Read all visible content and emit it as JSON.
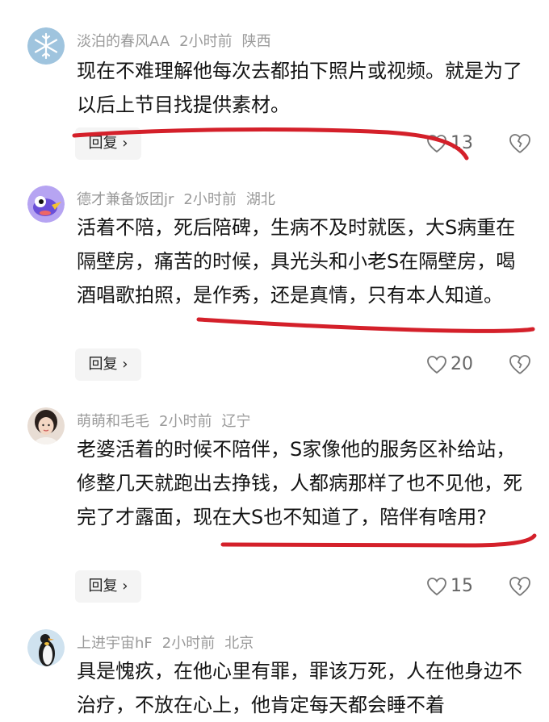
{
  "comments": [
    {
      "user": "淡泊的春风AA",
      "time": "2小时前",
      "location": "陕西",
      "text": "现在不难理解他每次去都拍下照片或视频。就是为了以后上节目找提供素材。",
      "reply_label": "回复 ›",
      "likes": "13",
      "avatar": "snowflake-avatar"
    },
    {
      "user": "德才兼备饭团jr",
      "time": "2小时前",
      "location": "湖北",
      "text": "活着不陪，死后陪碑，生病不及时就医，大S病重在隔壁房，痛苦的时候，具光头和小老S在隔壁房，喝酒唱歌拍照，是作秀，还是真情，只有本人知道。",
      "reply_label": "回复 ›",
      "likes": "20",
      "avatar": "cartoon-bird-avatar"
    },
    {
      "user": "萌萌和毛毛",
      "time": "2小时前",
      "location": "辽宁",
      "text": "老婆活着的时候不陪伴，S家像他的服务区补给站，修整几天就跑出去挣钱，人都病那样了也不见他，死完了才露面，现在大S也不知道了，陪伴有啥用?",
      "reply_label": "回复 ›",
      "likes": "15",
      "avatar": "girl-photo-avatar"
    },
    {
      "user": "上进宇宙hF",
      "time": "2小时前",
      "location": "北京",
      "text": "具是愧疚，在他心里有罪，罪该万死，人在他身边不治疗，不放在心上，他肯定每天都会睡不着",
      "avatar": "penguin-avatar"
    }
  ],
  "colors": {
    "annotation_red": "#d4202a",
    "meta_gray": "#9a9a9a"
  }
}
